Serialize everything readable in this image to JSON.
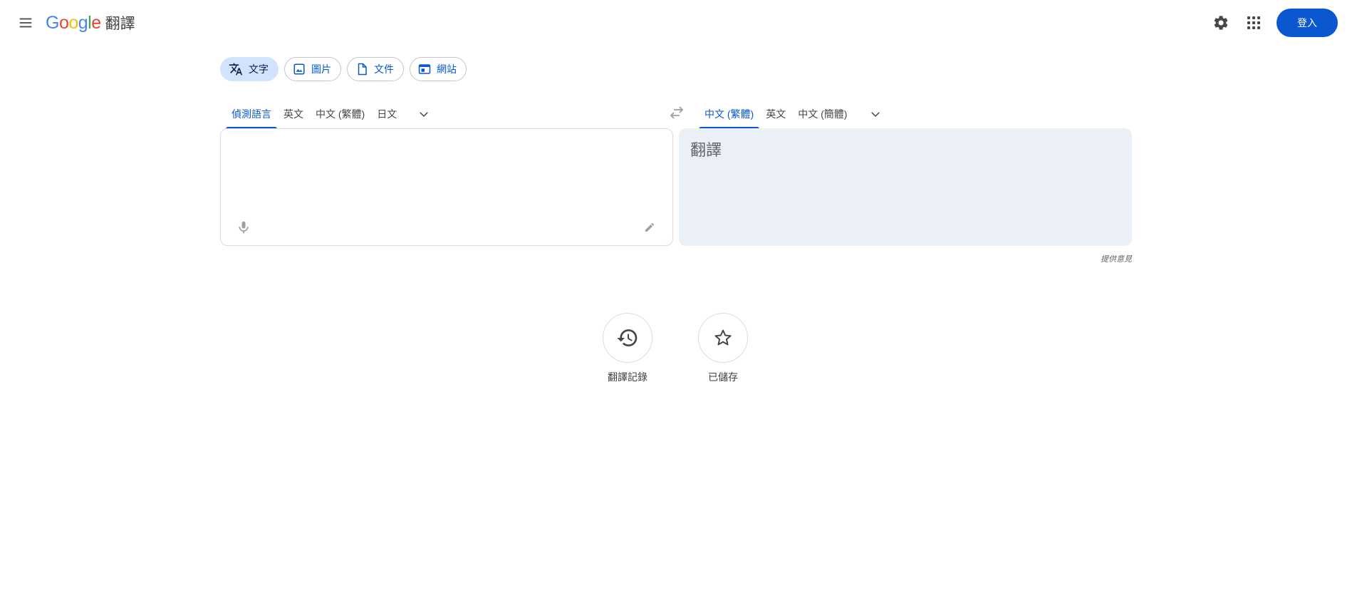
{
  "header": {
    "logo_letters": [
      {
        "ch": "G",
        "color": "#4285F4"
      },
      {
        "ch": "o",
        "color": "#EA4335"
      },
      {
        "ch": "o",
        "color": "#FBBC05"
      },
      {
        "ch": "g",
        "color": "#4285F4"
      },
      {
        "ch": "l",
        "color": "#34A853"
      },
      {
        "ch": "e",
        "color": "#EA4335"
      }
    ],
    "product": "翻譯",
    "signin_label": "登入",
    "icons": [
      "menu-icon",
      "settings-icon",
      "apps-grid-icon"
    ]
  },
  "modes": [
    {
      "label": "文字",
      "icon": "translate-icon",
      "active": true
    },
    {
      "label": "圖片",
      "icon": "image-icon",
      "active": false
    },
    {
      "label": "文件",
      "icon": "document-icon",
      "active": false
    },
    {
      "label": "網站",
      "icon": "website-icon",
      "active": false
    }
  ],
  "source_langs": [
    "偵測語言",
    "英文",
    "中文 (繁體)",
    "日文"
  ],
  "target_langs": [
    "中文 (繁體)",
    "英文",
    "中文 (簡體)"
  ],
  "source": {
    "value": "",
    "placeholder": ""
  },
  "target": {
    "text": "翻譯"
  },
  "feedback_label": "提供意見",
  "shortcuts": {
    "history_label": "翻譯記錄",
    "saved_label": "已儲存"
  },
  "colors": {
    "accent": "#0b57d0",
    "active_chip": "#d3e3fd",
    "target_bg": "#ebf0f7"
  }
}
